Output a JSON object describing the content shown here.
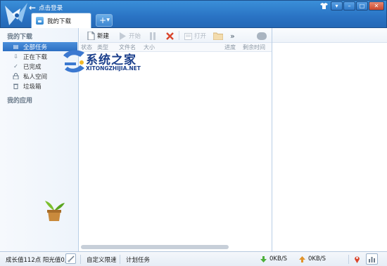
{
  "titlebar": {
    "login_label": "点击登录",
    "controls": [
      "shirt-icon",
      "menu-icon",
      "minimize-icon",
      "maximize-icon",
      "close-icon"
    ]
  },
  "tabs": [
    {
      "label": "我的下载",
      "active": true
    }
  ],
  "add_tab_label": "+",
  "sidebar": {
    "section_downloads": "我的下载",
    "items": [
      {
        "label": "全部任务",
        "icon": "list-icon",
        "active": true
      },
      {
        "label": "正在下载",
        "icon": "download-arrow-icon",
        "active": false
      },
      {
        "label": "已完成",
        "icon": "check-icon",
        "active": false
      },
      {
        "label": "私人空间",
        "icon": "lock-icon",
        "active": false
      },
      {
        "label": "垃圾箱",
        "icon": "trash-icon",
        "active": false
      }
    ],
    "section_apps": "我的应用"
  },
  "toolbar": {
    "new_label": "新建",
    "start_label": "开始",
    "open_label": "打开",
    "more_label": "»"
  },
  "columns": [
    "状态",
    "类型",
    "文件名",
    "大小",
    "进度",
    "剩余时间"
  ],
  "watermark": {
    "title": "系统之家",
    "url": "XITONGZHIJIA.NET"
  },
  "status": {
    "growth": "成长值112点 阳光值0点",
    "custom_speed": "自定义限速",
    "schedule": "计划任务",
    "download_speed": "0KB/S",
    "upload_speed": "0KB/S"
  },
  "colors": {
    "title_bar": "#2a73c4",
    "active_item": "#2c6fc2",
    "download_arrow": "#4caf3a",
    "upload_arrow": "#e0932a",
    "delete": "#d9452c"
  }
}
